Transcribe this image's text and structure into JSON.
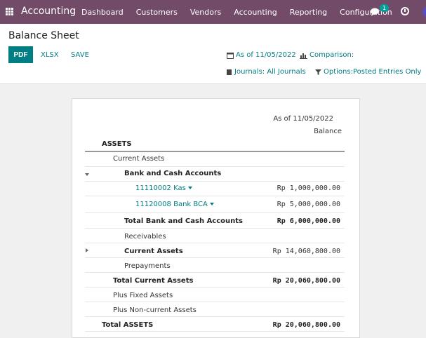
{
  "navbar": {
    "brand": "Accounting",
    "menu": [
      "Dashboard",
      "Customers",
      "Vendors",
      "Accounting",
      "Reporting",
      "Configuration"
    ],
    "chat_count": "1"
  },
  "control": {
    "title": "Balance Sheet",
    "pdf_label": "PDF",
    "xlsx_label": "XLSX",
    "save_label": "SAVE",
    "date_filter": "As of 11/05/2022",
    "comparison_filter": "Comparison:",
    "journals_filter": "Journals: All Journals",
    "options_filter": "Options:Posted Entries Only"
  },
  "report": {
    "header_date": "As of 11/05/2022",
    "header_col": "Balance",
    "rows": [
      {
        "label": "ASSETS",
        "amount": ""
      },
      {
        "label": "Current Assets",
        "amount": ""
      },
      {
        "label": "Bank and Cash Accounts",
        "amount": ""
      },
      {
        "label": "11110002 Kas",
        "amount": "Rp 1,000,000.00"
      },
      {
        "label": "11120008 Bank BCA",
        "amount": "Rp 5,000,000.00"
      },
      {
        "label": "Total Bank and Cash Accounts",
        "amount": "Rp 6,000,000.00"
      },
      {
        "label": "Receivables",
        "amount": ""
      },
      {
        "label": "Current Assets",
        "amount": "Rp 14,060,800.00"
      },
      {
        "label": "Prepayments",
        "amount": ""
      },
      {
        "label": "Total Current Assets",
        "amount": "Rp 20,060,800.00"
      },
      {
        "label": "Plus Fixed Assets",
        "amount": ""
      },
      {
        "label": "Plus Non-current Assets",
        "amount": ""
      },
      {
        "label": "Total ASSETS",
        "amount": "Rp 20,060,800.00"
      }
    ]
  }
}
